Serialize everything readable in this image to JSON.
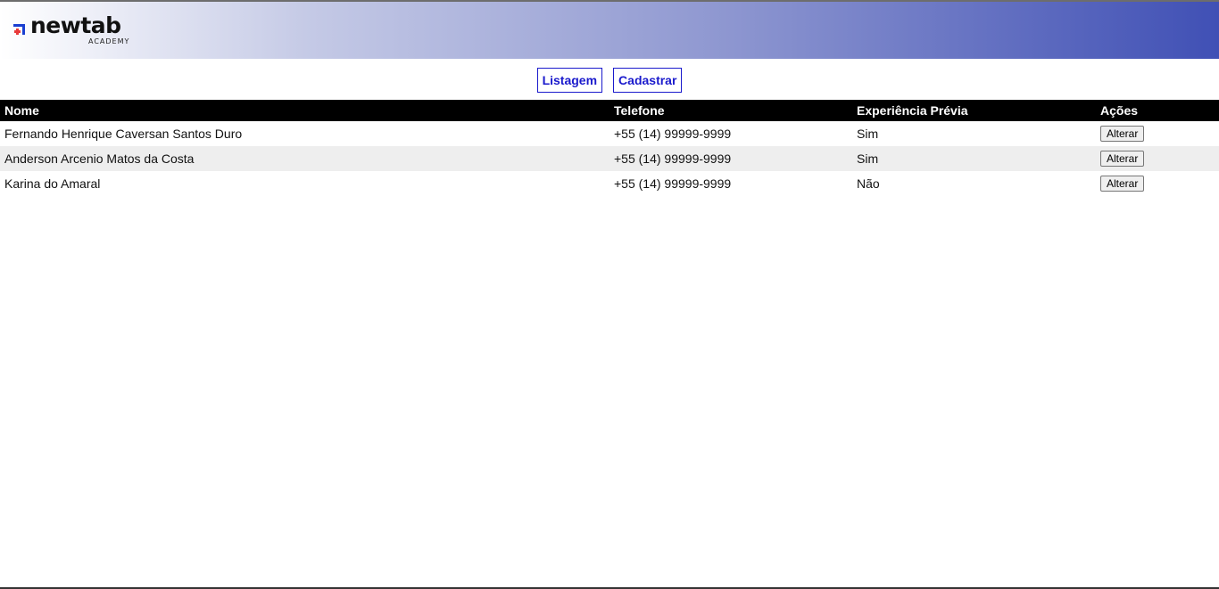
{
  "brand": {
    "name": "newtab",
    "sub": "ACADEMY",
    "mark_colors": [
      "#1a3fd1",
      "#e83a3a"
    ]
  },
  "nav": {
    "list_label": "Listagem",
    "register_label": "Cadastrar"
  },
  "table": {
    "headers": [
      "Nome",
      "Telefone",
      "Experiência Prévia",
      "Ações"
    ],
    "rows": [
      {
        "name": "Fernando Henrique Caversan Santos Duro",
        "phone": "+55 (14) 99999-9999",
        "experience": "Sim",
        "action": "Alterar"
      },
      {
        "name": "Anderson Arcenio Matos da Costa",
        "phone": "+55 (14) 99999-9999",
        "experience": "Sim",
        "action": "Alterar"
      },
      {
        "name": "Karina do Amaral",
        "phone": "+55 (14) 99999-9999",
        "experience": "Não",
        "action": "Alterar"
      }
    ]
  },
  "colors": {
    "header_gradient_end": "#4050b5",
    "nav_accent": "#1a1acc",
    "table_header_bg": "#000000",
    "row_alt_bg": "#eeeeee"
  }
}
